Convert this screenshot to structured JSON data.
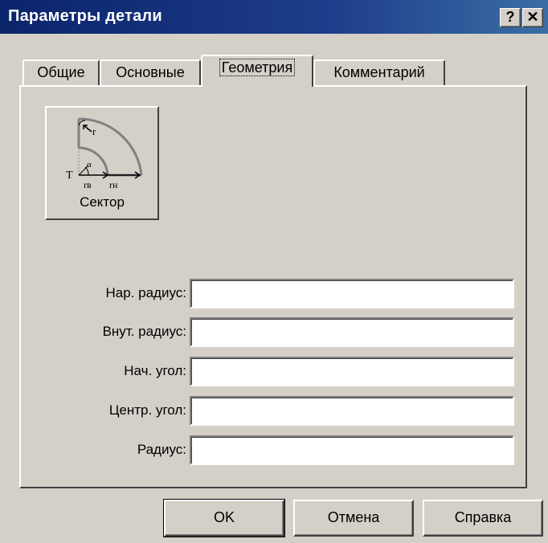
{
  "window": {
    "title": "Параметры детали",
    "help_label": "?",
    "close_label": "✕"
  },
  "tabs": [
    {
      "label": "Общие"
    },
    {
      "label": "Основные"
    },
    {
      "label": "Геометрия"
    },
    {
      "label": "Комментарий"
    }
  ],
  "active_tab": "Геометрия",
  "shape_button": {
    "label": "Сектор",
    "icon_labels": {
      "r": "r",
      "T": "T",
      "alpha": "α",
      "r_inner": "rв",
      "r_outer": "rн"
    }
  },
  "fields": [
    {
      "label": "Нар. радиус:",
      "value": ""
    },
    {
      "label": "Внут. радиус:",
      "value": ""
    },
    {
      "label": "Нач. угол:",
      "value": ""
    },
    {
      "label": "Центр. угол:",
      "value": ""
    },
    {
      "label": "Радиус:",
      "value": ""
    }
  ],
  "buttons": {
    "ok": "OK",
    "cancel": "Отмена",
    "help": "Справка"
  },
  "colors": {
    "titlebar": "#0a246a",
    "face": "#d4d0c8"
  }
}
